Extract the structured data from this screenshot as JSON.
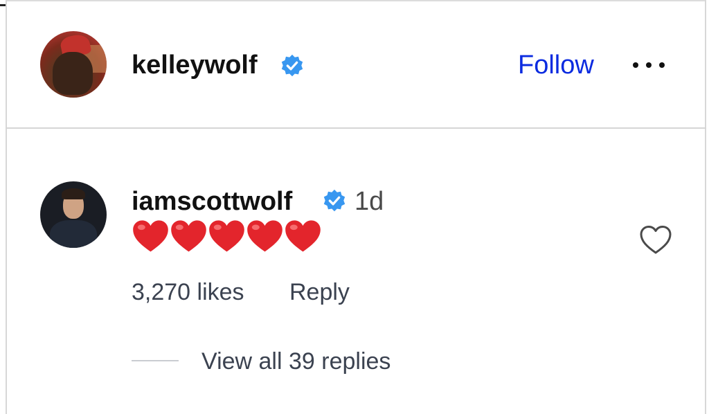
{
  "post_header": {
    "username": "kelleywolf",
    "verified": true,
    "follow_label": "Follow",
    "more_icon": "more-horizontal-icon"
  },
  "comment": {
    "username": "iamscottwolf",
    "verified": true,
    "time_ago": "1d",
    "text": "❤️❤️❤️❤️❤️",
    "heart_count": 5,
    "likes_label": "3,270 likes",
    "reply_label": "Reply",
    "view_replies_label": "View all 39 replies",
    "like_icon": "heart-outline-icon"
  },
  "colors": {
    "follow_blue": "#0b2be0",
    "verified_blue": "#3897f0",
    "heart_red": "#e3252c",
    "meta_gray": "#3b4250"
  }
}
